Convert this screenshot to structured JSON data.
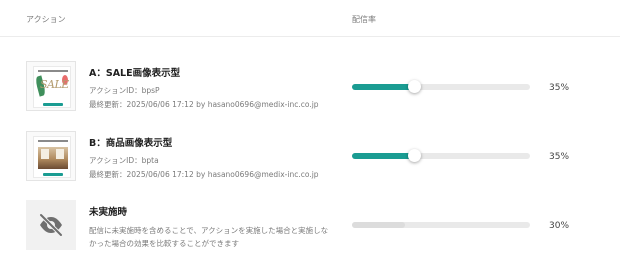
{
  "header": {
    "action_label": "アクション",
    "rate_label": "配信率"
  },
  "rows": [
    {
      "name": "A：SALE画像表示型",
      "action_id": "アクションID：bpsP",
      "updated": "最終更新：2025/06/06 17:12 by hasano0696@medix-inc.co.jp",
      "rate": 35,
      "rate_label": "35%",
      "thumb_icon": "sale-banner-thumbnail"
    },
    {
      "name": "B：商品画像表示型",
      "action_id": "アクションID：bpta",
      "updated": "最終更新：2025/06/06 17:12 by hasano0696@medix-inc.co.jp",
      "rate": 35,
      "rate_label": "35%",
      "thumb_icon": "product-image-thumbnail"
    },
    {
      "name": "未実施時",
      "description": "配信に未実施時を含めることで、アクションを実施した場合と実施しなかった場合の効果を比較することができます",
      "rate": 30,
      "rate_label": "30%",
      "thumb_icon": "eye-off-icon"
    }
  ],
  "colors": {
    "accent": "#1a9c92",
    "track": "#e9e9e9"
  }
}
